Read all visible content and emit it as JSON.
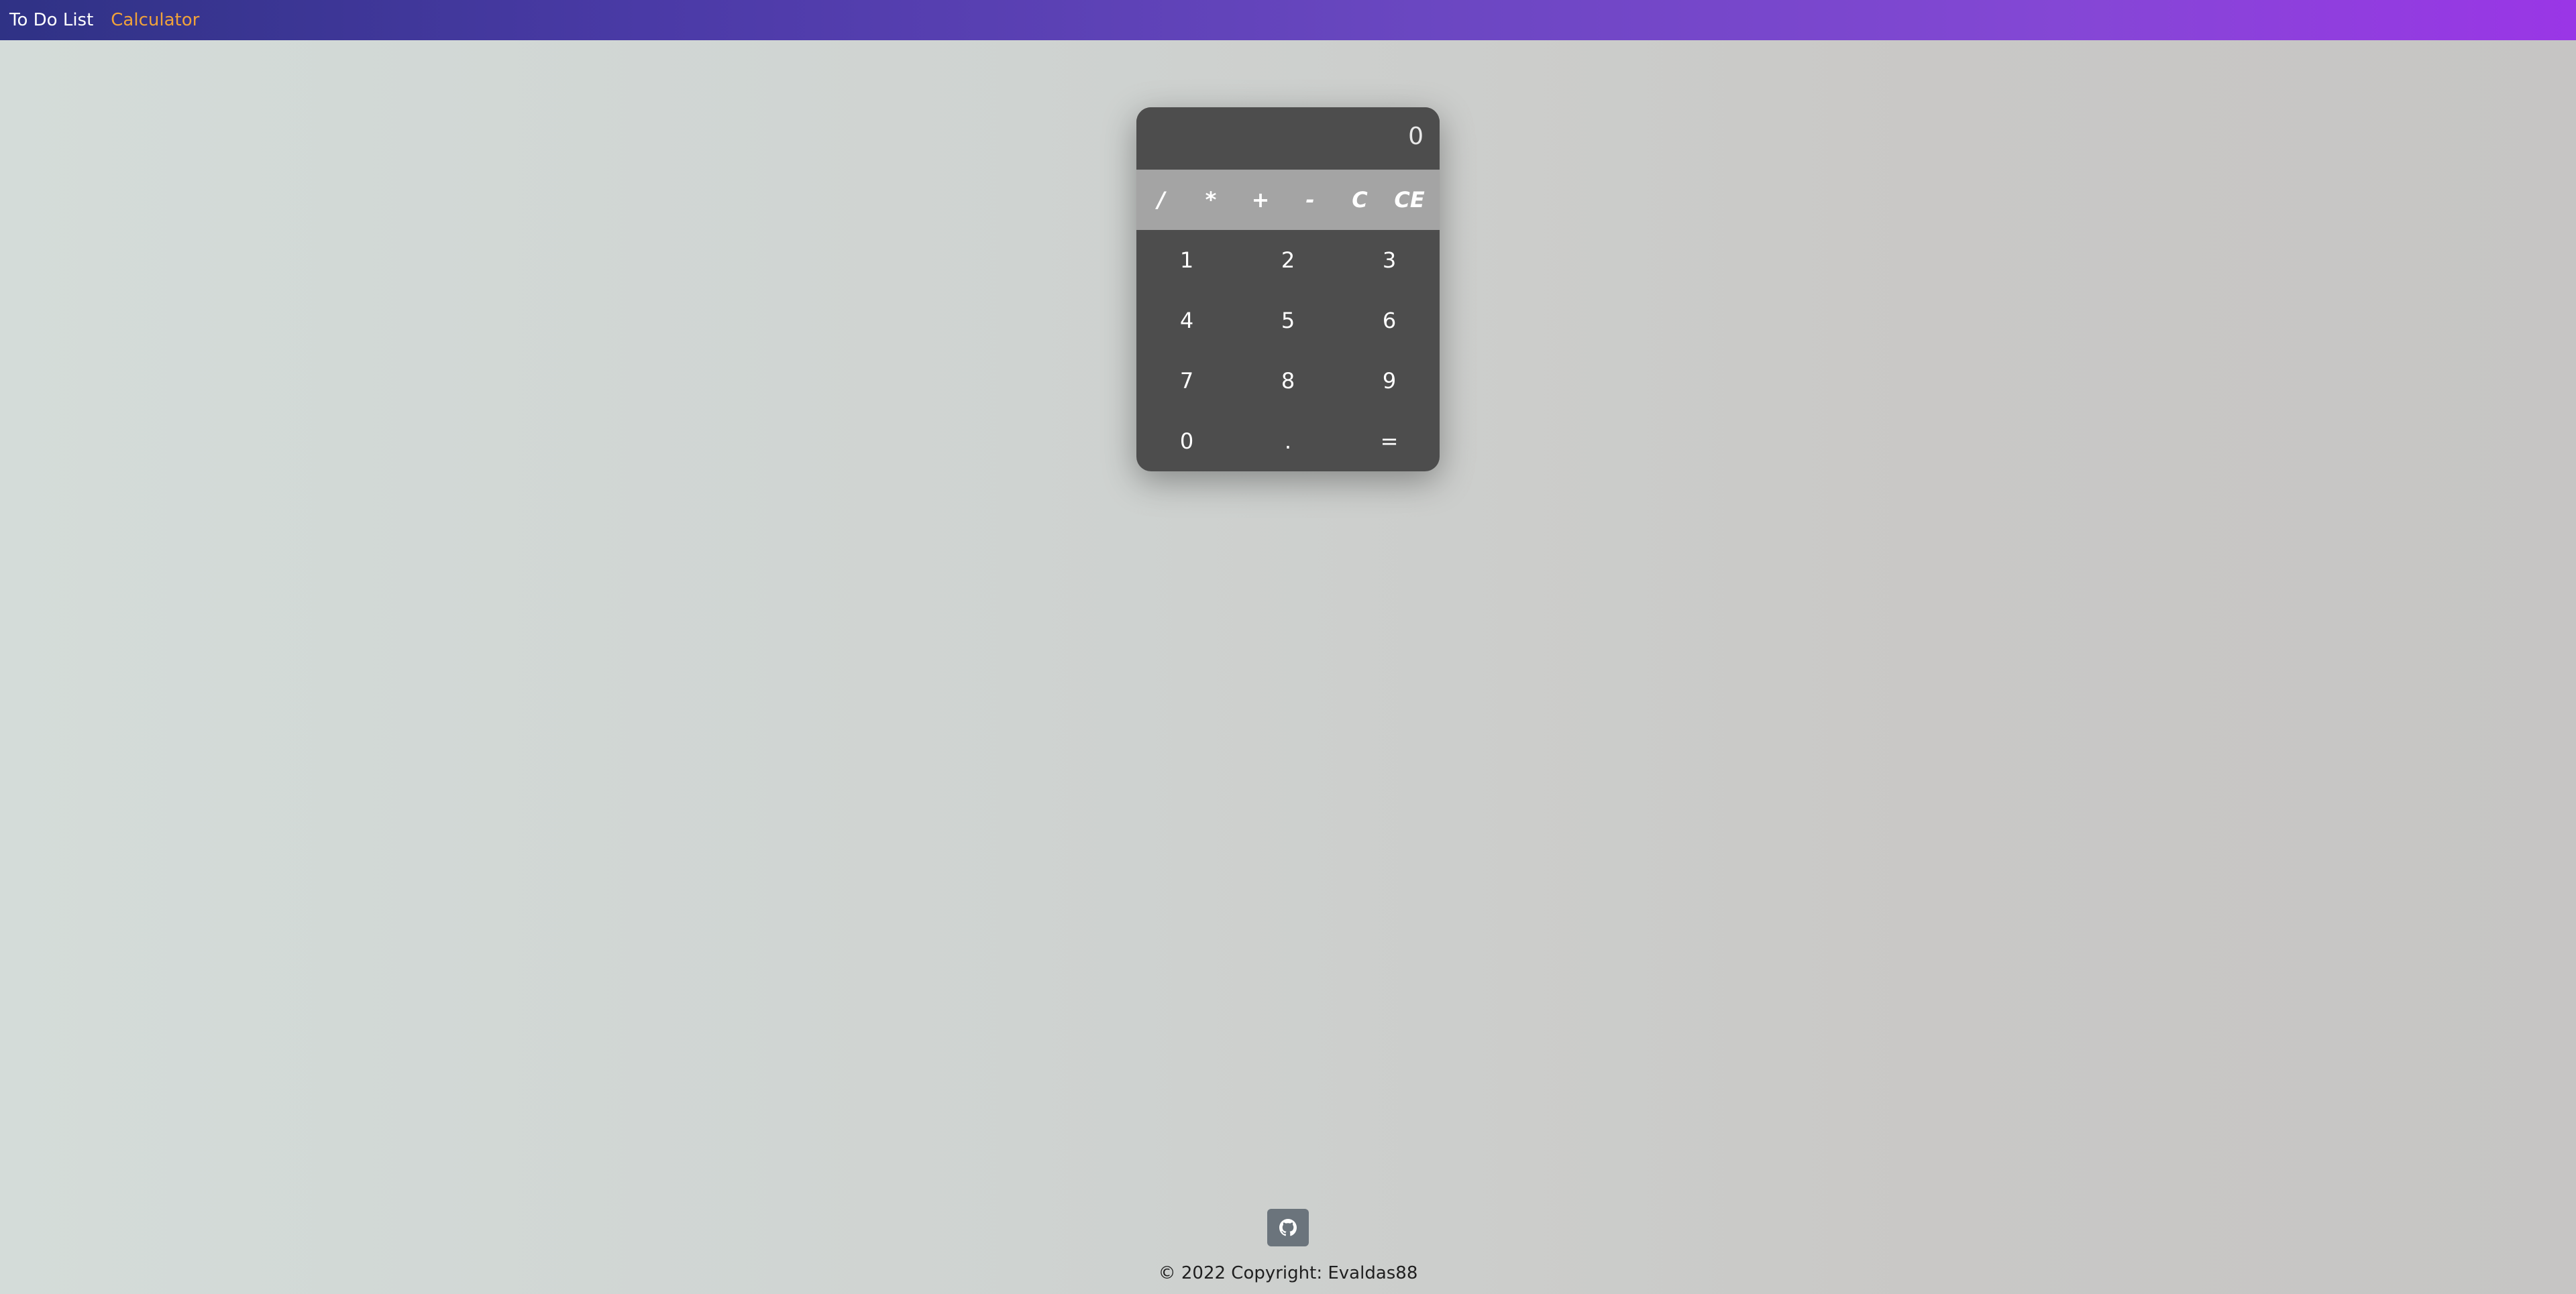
{
  "navbar": {
    "links": [
      {
        "label": "To Do List",
        "active": false
      },
      {
        "label": "Calculator",
        "active": true
      }
    ],
    "gradient": [
      "#2f3285",
      "#9a36e6"
    ],
    "active_color": "#f0a23a"
  },
  "calculator": {
    "display": "0",
    "operators": [
      "/",
      "*",
      "+",
      "-",
      "C",
      "CE"
    ],
    "keys": [
      [
        "1",
        "2",
        "3"
      ],
      [
        "4",
        "5",
        "6"
      ],
      [
        "7",
        "8",
        "9"
      ],
      [
        "0",
        ".",
        "="
      ]
    ],
    "body_color": "#4d4d4d",
    "operator_bar_color": "#a4a4a4"
  },
  "footer": {
    "github_icon": "github-icon",
    "copyright": "© 2022 Copyright: Evaldas88"
  }
}
